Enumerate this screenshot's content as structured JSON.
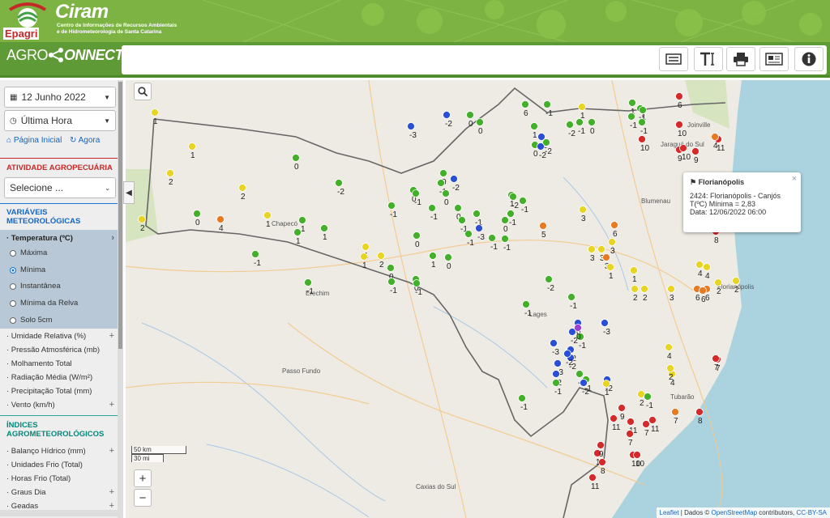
{
  "header": {
    "logo_text": "Epagri",
    "org_name": "Ciram",
    "org_subtitle": "Centro de Informações de Recursos Ambientais e de Hidrometeorologia de Santa Catarina",
    "app_logo_left": "AGRO",
    "app_logo_right": "ONNECT"
  },
  "toolbar": {
    "buttons": [
      {
        "name": "list-icon"
      },
      {
        "name": "text-size-icon"
      },
      {
        "name": "print-icon"
      },
      {
        "name": "newspaper-icon"
      },
      {
        "name": "info-icon"
      }
    ]
  },
  "sidebar": {
    "date_select": "12 Junho 2022",
    "time_select": "Última Hora",
    "home_link": "Página Inicial",
    "now_link": "Agora",
    "atividade_title": "ATIVIDADE AGROPECUÁRIA",
    "atividade_select": "Selecione ...",
    "variaveis_title": "VARIÁVEIS METEOROLÓGICAS",
    "temperatura_label": "· Temperatura (ºC)",
    "temp_options": [
      {
        "label": "Máxima",
        "checked": false
      },
      {
        "label": "Mínima",
        "checked": true
      },
      {
        "label": "Instantânea",
        "checked": false
      },
      {
        "label": "Mínima da Relva",
        "checked": false
      },
      {
        "label": "Solo 5cm",
        "checked": false
      }
    ],
    "other_vars": [
      {
        "label": "· Umidade Relativa (%)",
        "plus": "+"
      },
      {
        "label": "· Pressão Atmosférica (mb)",
        "plus": ""
      },
      {
        "label": "· Molhamento Total",
        "plus": ""
      },
      {
        "label": "· Radiação Média (W/m²)",
        "plus": ""
      },
      {
        "label": "· Precipitação Total (mm)",
        "plus": ""
      },
      {
        "label": "· Vento (km/h)",
        "plus": "+"
      }
    ],
    "indices_title": "ÍNDICES AGROMETEOROLÓGICOS",
    "indices": [
      {
        "label": "· Balanço Hídrico (mm)",
        "plus": "+"
      },
      {
        "label": "· Unidades Frio (Total)",
        "plus": ""
      },
      {
        "label": "· Horas Frio (Total)",
        "plus": ""
      },
      {
        "label": "· Graus Dia",
        "plus": "+"
      },
      {
        "label": "· Geadas",
        "plus": "+"
      }
    ]
  },
  "map": {
    "places": [
      "Chapecó",
      "Erechim",
      "Passo Fundo",
      "Caxias do Sul",
      "Lages",
      "Tubarão",
      "Joinville",
      "Jaraguá do Sul",
      "Blumenau",
      "Florianópolis"
    ],
    "popup": {
      "title": "Florianópolis",
      "line1": "2424: Florianópolis - Canjós",
      "line2": "T(ºC) Mínima = 2,83",
      "line3": "Data: 12/06/2022 06:00"
    },
    "scale_km": "50 km",
    "scale_mi": "30 mi",
    "attribution_leaflet": "Leaflet",
    "attribution_rest": "| Dados © ",
    "attribution_osm": "OpenStreetMap",
    "attribution_contrib": " contributors, ",
    "attribution_license": "CC-BY-SA",
    "colors": {
      "green": "#43b02a",
      "yellow": "#e8d422",
      "blue": "#2a4fd6",
      "orange": "#e87a22",
      "red": "#d62a2a",
      "purple": "#9b3fd6"
    },
    "stations": [
      {
        "c": "yellow",
        "v": "1"
      },
      {
        "c": "yellow",
        "v": "1"
      },
      {
        "c": "yellow",
        "v": "2"
      },
      {
        "c": "yellow",
        "v": "2"
      },
      {
        "c": "yellow",
        "v": "2"
      },
      {
        "c": "green",
        "v": "0"
      },
      {
        "c": "orange",
        "v": "4"
      },
      {
        "c": "yellow",
        "v": "1"
      },
      {
        "c": "green",
        "v": "1"
      },
      {
        "c": "green",
        "v": "1"
      },
      {
        "c": "green",
        "v": "0"
      },
      {
        "c": "green",
        "v": "-1"
      },
      {
        "c": "yellow",
        "v": "1"
      },
      {
        "c": "yellow",
        "v": "2"
      },
      {
        "c": "green",
        "v": "0"
      },
      {
        "c": "green",
        "v": "-1"
      },
      {
        "c": "green",
        "v": "0"
      },
      {
        "c": "blue",
        "v": "-3"
      },
      {
        "c": "blue",
        "v": "-2"
      },
      {
        "c": "green",
        "v": "0"
      },
      {
        "c": "green",
        "v": "0"
      },
      {
        "c": "green",
        "v": "-2"
      },
      {
        "c": "green",
        "v": "0"
      },
      {
        "c": "green",
        "v": "0"
      },
      {
        "c": "blue",
        "v": "-2"
      },
      {
        "c": "green",
        "v": "-1"
      },
      {
        "c": "green",
        "v": "0"
      },
      {
        "c": "green",
        "v": "-1"
      },
      {
        "c": "green",
        "v": "-1"
      },
      {
        "c": "green",
        "v": "0"
      },
      {
        "c": "green",
        "v": "-1"
      },
      {
        "c": "blue",
        "v": "-3"
      },
      {
        "c": "green",
        "v": "-1"
      },
      {
        "c": "green",
        "v": "-1"
      },
      {
        "c": "green",
        "v": "-1"
      },
      {
        "c": "green",
        "v": "0"
      },
      {
        "c": "green",
        "v": "1"
      },
      {
        "c": "green",
        "v": "-1"
      },
      {
        "c": "green",
        "v": "-1"
      },
      {
        "c": "green",
        "v": "-2"
      },
      {
        "c": "green",
        "v": "-1"
      },
      {
        "c": "blue",
        "v": "-2"
      },
      {
        "c": "green",
        "v": "-2"
      },
      {
        "c": "green",
        "v": "6"
      },
      {
        "c": "green",
        "v": "-1"
      },
      {
        "c": "green",
        "v": "1"
      },
      {
        "c": "green",
        "v": "0"
      },
      {
        "c": "blue",
        "v": "-2"
      },
      {
        "c": "green",
        "v": "-2"
      },
      {
        "c": "yellow",
        "v": "1"
      },
      {
        "c": "green",
        "v": "-1"
      },
      {
        "c": "green",
        "v": "0"
      },
      {
        "c": "green",
        "v": "1"
      },
      {
        "c": "green",
        "v": "-1"
      },
      {
        "c": "green",
        "v": "-1"
      },
      {
        "c": "green",
        "v": "1"
      },
      {
        "c": "green",
        "v": "-1"
      },
      {
        "c": "yellow",
        "v": "3"
      },
      {
        "c": "orange",
        "v": "5"
      },
      {
        "c": "orange",
        "v": "6"
      },
      {
        "c": "yellow",
        "v": "3"
      },
      {
        "c": "yellow",
        "v": "3"
      },
      {
        "c": "orange",
        "v": "3"
      },
      {
        "c": "yellow",
        "v": "1"
      },
      {
        "c": "yellow",
        "v": "1"
      },
      {
        "c": "yellow",
        "v": "3"
      },
      {
        "c": "yellow",
        "v": "2"
      },
      {
        "c": "yellow",
        "v": "2"
      },
      {
        "c": "yellow",
        "v": "3"
      },
      {
        "c": "yellow",
        "v": "4"
      },
      {
        "c": "orange",
        "v": "6"
      },
      {
        "c": "orange",
        "v": "6"
      },
      {
        "c": "yellow",
        "v": "2"
      },
      {
        "c": "green",
        "v": "-2"
      },
      {
        "c": "green",
        "v": "-1"
      },
      {
        "c": "green",
        "v": "-1"
      },
      {
        "c": "blue",
        "v": "0"
      },
      {
        "c": "blue",
        "v": "-2"
      },
      {
        "c": "blue",
        "v": "-3"
      },
      {
        "c": "blue",
        "v": "-2"
      },
      {
        "c": "blue",
        "v": "-3"
      },
      {
        "c": "blue",
        "v": "-2"
      },
      {
        "c": "green",
        "v": "-4"
      },
      {
        "c": "green",
        "v": "-1"
      },
      {
        "c": "blue",
        "v": "-2"
      },
      {
        "c": "yellow",
        "v": "2"
      },
      {
        "c": "yellow",
        "v": "4"
      },
      {
        "c": "yellow",
        "v": "4"
      },
      {
        "c": "yellow",
        "v": "4"
      },
      {
        "c": "red",
        "v": "7"
      },
      {
        "c": "red",
        "v": "9"
      },
      {
        "c": "red",
        "v": "11"
      },
      {
        "c": "red",
        "v": "11"
      },
      {
        "c": "red",
        "v": "7"
      },
      {
        "c": "red",
        "v": "7"
      },
      {
        "c": "orange",
        "v": "7"
      },
      {
        "c": "red",
        "v": "8"
      },
      {
        "c": "red",
        "v": "11"
      },
      {
        "c": "red",
        "v": "10"
      },
      {
        "c": "red",
        "v": "8"
      },
      {
        "c": "red",
        "v": "9"
      },
      {
        "c": "red",
        "v": "10"
      },
      {
        "c": "red",
        "v": "10"
      },
      {
        "c": "red",
        "v": "11"
      },
      {
        "c": "blue",
        "v": "-3"
      },
      {
        "c": "blue",
        "v": "-2"
      },
      {
        "c": "blue",
        "v": "-2"
      },
      {
        "c": "blue",
        "v": "-2"
      },
      {
        "c": "green",
        "v": "-1"
      },
      {
        "c": "green",
        "v": "-1"
      },
      {
        "c": "green",
        "v": "-1"
      },
      {
        "c": "yellow",
        "v": "1"
      },
      {
        "c": "yellow",
        "v": "2"
      },
      {
        "c": "red",
        "v": "6"
      },
      {
        "c": "red",
        "v": "11"
      },
      {
        "c": "red",
        "v": "10"
      },
      {
        "c": "red",
        "v": "10"
      },
      {
        "c": "red",
        "v": "9"
      },
      {
        "c": "red",
        "v": "9"
      },
      {
        "c": "red",
        "v": "10"
      },
      {
        "c": "orange",
        "v": "4"
      },
      {
        "c": "green",
        "v": "1"
      },
      {
        "c": "green",
        "v": "0"
      },
      {
        "c": "green",
        "v": "-1"
      },
      {
        "c": "green",
        "v": "1"
      },
      {
        "c": "yellow",
        "v": "1"
      },
      {
        "c": "green",
        "v": "-1"
      },
      {
        "c": "green",
        "v": "0"
      },
      {
        "c": "purple",
        "v": "0"
      },
      {
        "c": "green",
        "v": "-1"
      },
      {
        "c": "red",
        "v": "8"
      },
      {
        "c": "red",
        "v": "7"
      },
      {
        "c": "orange",
        "v": "6"
      },
      {
        "c": "yellow",
        "v": "2"
      },
      {
        "c": "green",
        "v": "-1"
      }
    ]
  }
}
